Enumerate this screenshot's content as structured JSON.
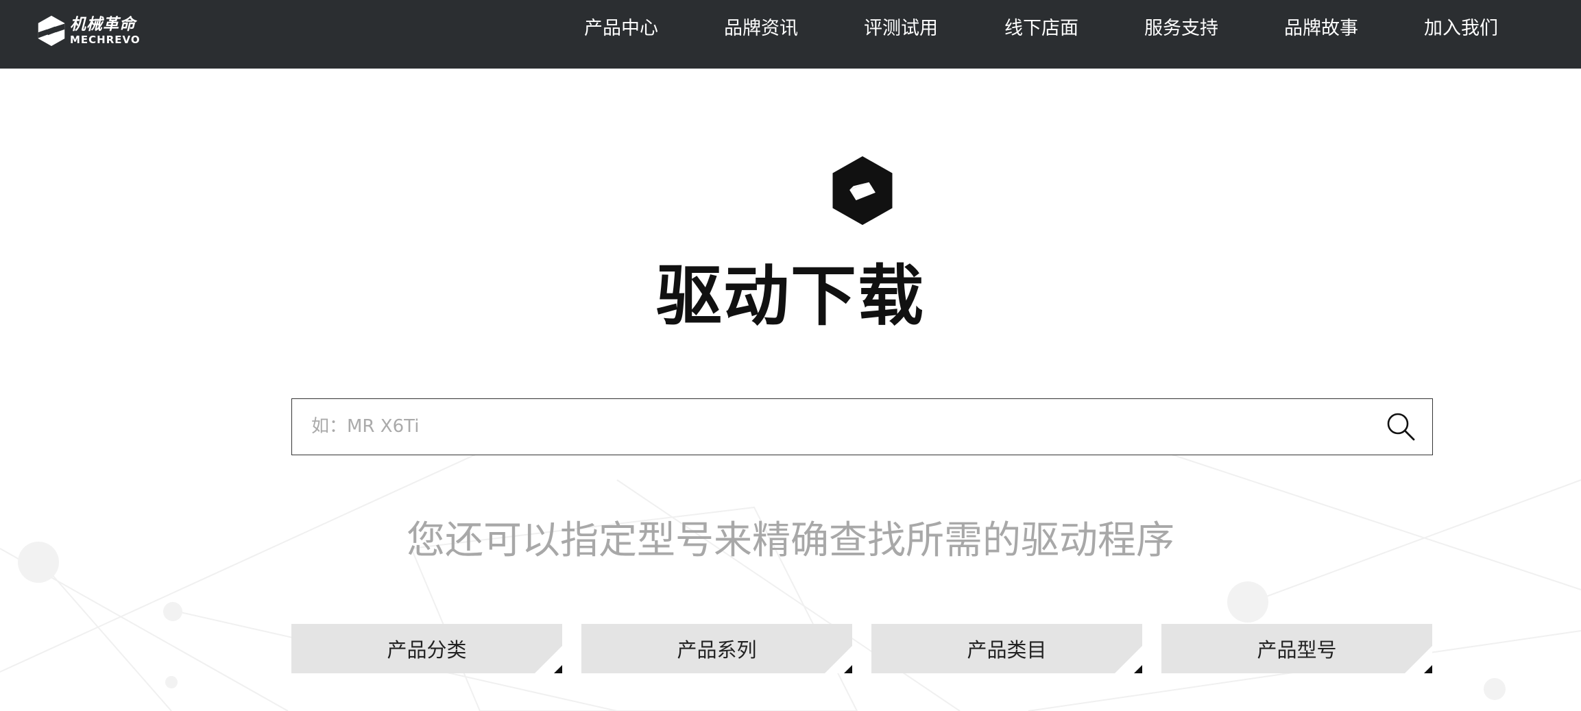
{
  "brand": {
    "name_cn": "机械革命",
    "name_en": "MECHREVO"
  },
  "nav": {
    "items": [
      {
        "label": "产品中心"
      },
      {
        "label": "品牌资讯"
      },
      {
        "label": "评测试用"
      },
      {
        "label": "线下店面"
      },
      {
        "label": "服务支持"
      },
      {
        "label": "品牌故事"
      },
      {
        "label": "加入我们"
      }
    ]
  },
  "page": {
    "title": "驱动下载"
  },
  "search": {
    "placeholder": "如：MR X6Ti",
    "value": "",
    "icon": "search-icon"
  },
  "hint": "您还可以指定型号来精确查找所需的驱动程序",
  "filters": [
    {
      "label": "产品分类"
    },
    {
      "label": "产品系列"
    },
    {
      "label": "产品类目"
    },
    {
      "label": "产品型号"
    }
  ],
  "colors": {
    "topbar": "#2b2e31",
    "filter_bg": "#e4e4e4",
    "hint_text": "#a8a8a8"
  }
}
